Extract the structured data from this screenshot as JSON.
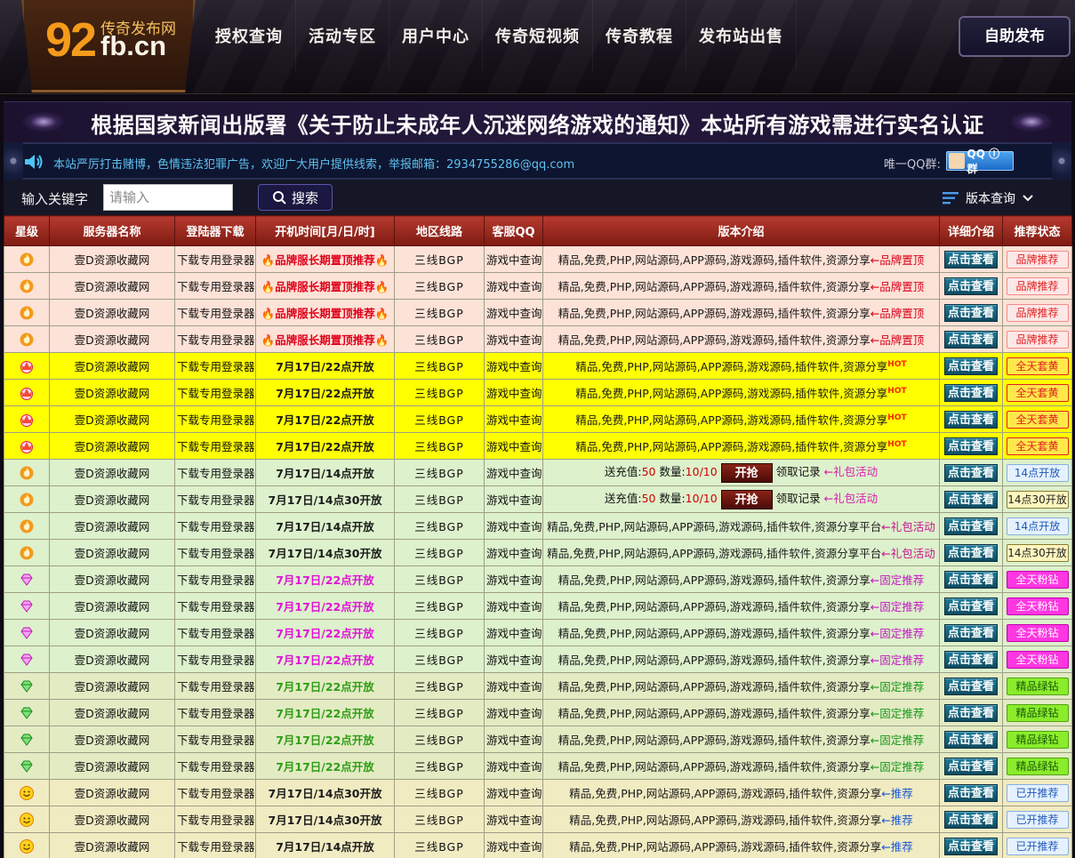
{
  "header": {
    "logo_num": "92",
    "logo_sub": "传奇发布网",
    "logo_domain": "fb.cn",
    "nav": [
      "授权查询",
      "活动专区",
      "用户中心",
      "传奇短视频",
      "传奇教程",
      "发布站出售"
    ],
    "publish_button": "自助发布"
  },
  "notice": {
    "text": "根据国家新闻出版署《关于防止未成年人沉迷网络游戏的通知》本站所有游戏需进行实名认证"
  },
  "marquee": {
    "text": "本站严厉打击赌博，色情违法犯罪广告，欢迎广大用户提供线索，举报邮箱：2934755286@qq.com",
    "qq_label": "唯一QQ群:",
    "qq_badge": "QQ ⓘ 群"
  },
  "search": {
    "label": "输入关键字",
    "placeholder": "请输入",
    "button": "搜索",
    "version_menu": "版本查询"
  },
  "table": {
    "headers": [
      "星级",
      "服务器名称",
      "登陆器下载",
      "开机时间[月/日/时]",
      "地区线路",
      "客服QQ",
      "版本介绍",
      "详细介绍",
      "推荐状态"
    ],
    "rows": [
      {
        "theme": "pink",
        "icon": "fire-icon",
        "name": "壹D资源收藏网",
        "download": "下载专用登录器",
        "time": "🔥品牌服长期置顶推荐🔥",
        "time_style": "brand",
        "line": "三线BGP",
        "qq": "游戏中查询",
        "intro": "精品,免费,PHP,网站源码,APP源码,游戏源码,插件软件,资源分享",
        "suffix": "←品牌置顶",
        "suffix_style": "red",
        "view": "点击查看",
        "status": "品牌推荐",
        "status_style": "brand"
      },
      {
        "theme": "pink",
        "icon": "fire-icon",
        "name": "壹D资源收藏网",
        "download": "下载专用登录器",
        "time": "🔥品牌服长期置顶推荐🔥",
        "time_style": "brand",
        "line": "三线BGP",
        "qq": "游戏中查询",
        "intro": "精品,免费,PHP,网站源码,APP源码,游戏源码,插件软件,资源分享",
        "suffix": "←品牌置顶",
        "suffix_style": "red",
        "view": "点击查看",
        "status": "品牌推荐",
        "status_style": "brand"
      },
      {
        "theme": "pink",
        "icon": "fire-icon",
        "name": "壹D资源收藏网",
        "download": "下载专用登录器",
        "time": "🔥品牌服长期置顶推荐🔥",
        "time_style": "brand",
        "line": "三线BGP",
        "qq": "游戏中查询",
        "intro": "精品,免费,PHP,网站源码,APP源码,游戏源码,插件软件,资源分享",
        "suffix": "←品牌置顶",
        "suffix_style": "red",
        "view": "点击查看",
        "status": "品牌推荐",
        "status_style": "brand"
      },
      {
        "theme": "pink",
        "icon": "fire-icon",
        "name": "壹D资源收藏网",
        "download": "下载专用登录器",
        "time": "🔥品牌服长期置顶推荐🔥",
        "time_style": "brand",
        "line": "三线BGP",
        "qq": "游戏中查询",
        "intro": "精品,免费,PHP,网站源码,APP源码,游戏源码,插件软件,资源分享",
        "suffix": "←品牌置顶",
        "suffix_style": "red",
        "view": "点击查看",
        "status": "品牌推荐",
        "status_style": "brand"
      },
      {
        "theme": "yellow",
        "icon": "crown-icon",
        "name": "壹D资源收藏网",
        "download": "下载专用登录器",
        "time": "7月17日/22点开放",
        "time_style": "default",
        "line": "三线BGP",
        "qq": "游戏中查询",
        "intro": "精品,免费,PHP,网站源码,APP源码,游戏源码,插件软件,资源分享",
        "suffix": "HOT",
        "suffix_style": "hot",
        "view": "点击查看",
        "status": "全天套黄",
        "status_style": "yellow"
      },
      {
        "theme": "yellow",
        "icon": "crown-icon",
        "name": "壹D资源收藏网",
        "download": "下载专用登录器",
        "time": "7月17日/22点开放",
        "time_style": "default",
        "line": "三线BGP",
        "qq": "游戏中查询",
        "intro": "精品,免费,PHP,网站源码,APP源码,游戏源码,插件软件,资源分享",
        "suffix": "HOT",
        "suffix_style": "hot",
        "view": "点击查看",
        "status": "全天套黄",
        "status_style": "yellow"
      },
      {
        "theme": "yellow",
        "icon": "crown-icon",
        "name": "壹D资源收藏网",
        "download": "下载专用登录器",
        "time": "7月17日/22点开放",
        "time_style": "default",
        "line": "三线BGP",
        "qq": "游戏中查询",
        "intro": "精品,免费,PHP,网站源码,APP源码,游戏源码,插件软件,资源分享",
        "suffix": "HOT",
        "suffix_style": "hot",
        "view": "点击查看",
        "status": "全天套黄",
        "status_style": "yellow"
      },
      {
        "theme": "yellow",
        "icon": "crown-icon",
        "name": "壹D资源收藏网",
        "download": "下载专用登录器",
        "time": "7月17日/22点开放",
        "time_style": "default",
        "line": "三线BGP",
        "qq": "游戏中查询",
        "intro": "精品,免费,PHP,网站源码,APP源码,游戏源码,插件软件,资源分享",
        "suffix": "HOT",
        "suffix_style": "hot",
        "view": "点击查看",
        "status": "全天套黄",
        "status_style": "yellow"
      },
      {
        "theme": "green",
        "icon": "fire-icon",
        "name": "壹D资源收藏网",
        "download": "下载专用登录器",
        "time": "7月17日/14点开放",
        "time_style": "default",
        "line": "三线BGP",
        "qq": "游戏中查询",
        "gift": {
          "label": "送充值:",
          "value": "50",
          "count_label": "数量:",
          "count": "10/10",
          "grab": "开抢",
          "record": "领取记录",
          "link": "←礼包活动"
        },
        "view": "点击查看",
        "status": "14点开放",
        "status_style": "blue"
      },
      {
        "theme": "green",
        "icon": "fire-icon",
        "name": "壹D资源收藏网",
        "download": "下载专用登录器",
        "time": "7月17日/14点30开放",
        "time_style": "default",
        "line": "三线BGP",
        "qq": "游戏中查询",
        "gift": {
          "label": "送充值:",
          "value": "50",
          "count_label": "数量:",
          "count": "10/10",
          "grab": "开抢",
          "record": "领取记录",
          "link": "←礼包活动"
        },
        "view": "点击查看",
        "status": "14点30开放",
        "status_style": "yellow-b"
      },
      {
        "theme": "green",
        "icon": "fire-icon",
        "name": "壹D资源收藏网",
        "download": "下载专用登录器",
        "time": "7月17日/14点开放",
        "time_style": "default",
        "line": "三线BGP",
        "qq": "游戏中查询",
        "intro": "精品,免费,PHP,网站源码,APP源码,游戏源码,插件软件,资源分享平台",
        "suffix": "←礼包活动",
        "suffix_style": "pink",
        "view": "点击查看",
        "status": "14点开放",
        "status_style": "blue"
      },
      {
        "theme": "green",
        "icon": "fire-icon",
        "name": "壹D资源收藏网",
        "download": "下载专用登录器",
        "time": "7月17日/14点30开放",
        "time_style": "default",
        "line": "三线BGP",
        "qq": "游戏中查询",
        "intro": "精品,免费,PHP,网站源码,APP源码,游戏源码,插件软件,资源分享平台",
        "suffix": "←礼包活动",
        "suffix_style": "pink",
        "view": "点击查看",
        "status": "14点30开放",
        "status_style": "yellow-b"
      },
      {
        "theme": "green",
        "icon": "pink-diamond-icon",
        "name": "壹D资源收藏网",
        "download": "下载专用登录器",
        "time": "7月17日/22点开放",
        "time_style": "pink",
        "line": "三线BGP",
        "qq": "游戏中查询",
        "intro": "精品,免费,PHP,网站源码,APP源码,游戏源码,插件软件,资源分享",
        "suffix": "←固定推荐",
        "suffix_style": "magenta",
        "view": "点击查看",
        "status": "全天粉钻",
        "status_style": "pink"
      },
      {
        "theme": "green",
        "icon": "pink-diamond-icon",
        "name": "壹D资源收藏网",
        "download": "下载专用登录器",
        "time": "7月17日/22点开放",
        "time_style": "pink",
        "line": "三线BGP",
        "qq": "游戏中查询",
        "intro": "精品,免费,PHP,网站源码,APP源码,游戏源码,插件软件,资源分享",
        "suffix": "←固定推荐",
        "suffix_style": "magenta",
        "view": "点击查看",
        "status": "全天粉钻",
        "status_style": "pink"
      },
      {
        "theme": "green",
        "icon": "pink-diamond-icon",
        "name": "壹D资源收藏网",
        "download": "下载专用登录器",
        "time": "7月17日/22点开放",
        "time_style": "pink",
        "line": "三线BGP",
        "qq": "游戏中查询",
        "intro": "精品,免费,PHP,网站源码,APP源码,游戏源码,插件软件,资源分享",
        "suffix": "←固定推荐",
        "suffix_style": "magenta",
        "view": "点击查看",
        "status": "全天粉钻",
        "status_style": "pink"
      },
      {
        "theme": "green",
        "icon": "pink-diamond-icon",
        "name": "壹D资源收藏网",
        "download": "下载专用登录器",
        "time": "7月17日/22点开放",
        "time_style": "pink",
        "line": "三线BGP",
        "qq": "游戏中查询",
        "intro": "精品,免费,PHP,网站源码,APP源码,游戏源码,插件软件,资源分享",
        "suffix": "←固定推荐",
        "suffix_style": "magenta",
        "view": "点击查看",
        "status": "全天粉钻",
        "status_style": "pink"
      },
      {
        "theme": "green2",
        "icon": "green-diamond-icon",
        "name": "壹D资源收藏网",
        "download": "下载专用登录器",
        "time": "7月17日/22点开放",
        "time_style": "green",
        "line": "三线BGP",
        "qq": "游戏中查询",
        "intro": "精品,免费,PHP,网站源码,APP源码,游戏源码,插件软件,资源分享",
        "suffix": "←固定推荐",
        "suffix_style": "green",
        "view": "点击查看",
        "status": "精品绿钻",
        "status_style": "green"
      },
      {
        "theme": "green2",
        "icon": "green-diamond-icon",
        "name": "壹D资源收藏网",
        "download": "下载专用登录器",
        "time": "7月17日/22点开放",
        "time_style": "green",
        "line": "三线BGP",
        "qq": "游戏中查询",
        "intro": "精品,免费,PHP,网站源码,APP源码,游戏源码,插件软件,资源分享",
        "suffix": "←固定推荐",
        "suffix_style": "green",
        "view": "点击查看",
        "status": "精品绿钻",
        "status_style": "green"
      },
      {
        "theme": "green2",
        "icon": "green-diamond-icon",
        "name": "壹D资源收藏网",
        "download": "下载专用登录器",
        "time": "7月17日/22点开放",
        "time_style": "green",
        "line": "三线BGP",
        "qq": "游戏中查询",
        "intro": "精品,免费,PHP,网站源码,APP源码,游戏源码,插件软件,资源分享",
        "suffix": "←固定推荐",
        "suffix_style": "green",
        "view": "点击查看",
        "status": "精品绿钻",
        "status_style": "green"
      },
      {
        "theme": "green2",
        "icon": "green-diamond-icon",
        "name": "壹D资源收藏网",
        "download": "下载专用登录器",
        "time": "7月17日/22点开放",
        "time_style": "green",
        "line": "三线BGP",
        "qq": "游戏中查询",
        "intro": "精品,免费,PHP,网站源码,APP源码,游戏源码,插件软件,资源分享",
        "suffix": "←固定推荐",
        "suffix_style": "green",
        "view": "点击查看",
        "status": "精品绿钻",
        "status_style": "green"
      },
      {
        "theme": "yellow2",
        "icon": "smiley-icon",
        "name": "壹D资源收藏网",
        "download": "下载专用登录器",
        "time": "7月17日/14点30开放",
        "time_style": "default",
        "line": "三线BGP",
        "qq": "游戏中查询",
        "intro": "精品,免费,PHP,网站源码,APP源码,游戏源码,插件软件,资源分享",
        "suffix": "←推荐",
        "suffix_style": "blue",
        "view": "点击查看",
        "status": "已开推荐",
        "status_style": "blue"
      },
      {
        "theme": "yellow2",
        "icon": "smiley-icon",
        "name": "壹D资源收藏网",
        "download": "下载专用登录器",
        "time": "7月17日/14点30开放",
        "time_style": "default",
        "line": "三线BGP",
        "qq": "游戏中查询",
        "intro": "精品,免费,PHP,网站源码,APP源码,游戏源码,插件软件,资源分享",
        "suffix": "←推荐",
        "suffix_style": "blue",
        "view": "点击查看",
        "status": "已开推荐",
        "status_style": "blue"
      },
      {
        "theme": "yellow2",
        "icon": "smiley-icon",
        "name": "壹D资源收藏网",
        "download": "下载专用登录器",
        "time": "7月17日/14点开放",
        "time_style": "default",
        "line": "三线BGP",
        "qq": "游戏中查询",
        "intro": "精品,免费,PHP,网站源码,APP源码,游戏源码,插件软件,资源分享",
        "suffix": "←推荐",
        "suffix_style": "blue",
        "view": "点击查看",
        "status": "已开推荐",
        "status_style": "blue"
      }
    ]
  }
}
